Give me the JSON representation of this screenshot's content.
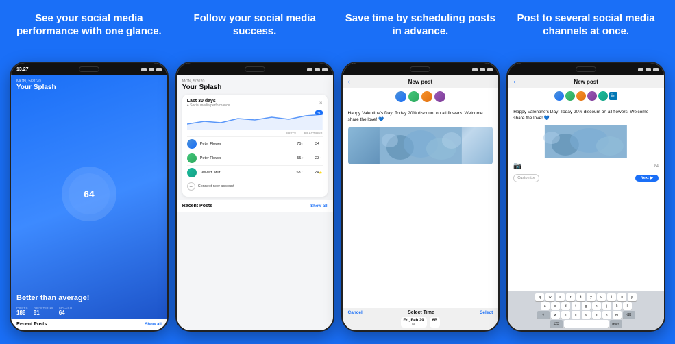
{
  "panels": [
    {
      "id": "panel1",
      "headline": "See your social media performance with one glance.",
      "phone": {
        "time": "13.27",
        "date": "MON, 5/2020",
        "screen_title": "Your Splash",
        "score": "64",
        "better_text": "Better than average!",
        "stats": [
          {
            "label": "POSTS",
            "value": "188"
          },
          {
            "label": "REACTIONS",
            "value": "81"
          },
          {
            "label": "SPLASH",
            "value": "64"
          }
        ],
        "recent_label": "Recent Posts",
        "show_all": "Show all"
      }
    },
    {
      "id": "panel2",
      "headline": "Follow your social media success.",
      "phone": {
        "date": "MON, 5/2020",
        "screen_title": "Your Splash",
        "card_title": "Last 30 days",
        "card_subtitle": "● Social media performance",
        "chart_badge": "+4",
        "table_headers": [
          "POSTS",
          "REACTIONS"
        ],
        "rows": [
          {
            "name": "Peter Flower",
            "posts": "75",
            "reactions": "34",
            "starred": false
          },
          {
            "name": "Peter Flower",
            "posts": "55",
            "reactions": "23",
            "starred": false
          },
          {
            "name": "Tesvetti Mur",
            "posts": "58",
            "reactions": "24",
            "starred": true
          }
        ],
        "connect_label": "Connect new account",
        "recent_label": "Recent Posts",
        "show_all": "Show all"
      }
    },
    {
      "id": "panel3",
      "headline": "Save time by scheduling posts in advance.",
      "phone": {
        "top_title": "New post",
        "post_text": "Happy Valentine's Day! Today 20% discount on all flowers. Welcome share the love! 💙",
        "bottom": {
          "cancel_label": "Cancel",
          "select_time_label": "Select Time",
          "select_label": "Select",
          "date_label": "Fri, Feb 29",
          "times": [
            {
              "day": "Fri, Feb 29",
              "slots": [
                "08",
                "6B"
              ]
            },
            {
              "day": "",
              "slots": []
            }
          ]
        }
      }
    },
    {
      "id": "panel4",
      "headline": "Post to several social media channels at once.",
      "phone": {
        "top_title": "New post",
        "post_text": "Happy Valentine's Day! Today 20% discount on all flowers. Welcome share the love! 💙",
        "char_count": "84",
        "customize_label": "Customize",
        "next_label": "Next",
        "keyboard_rows": [
          [
            "q",
            "w",
            "e",
            "r",
            "t",
            "y",
            "u",
            "i",
            "o",
            "p"
          ],
          [
            "a",
            "s",
            "d",
            "f",
            "g",
            "h",
            "j",
            "k",
            "l"
          ],
          [
            "↑",
            "z",
            "x",
            "c",
            "v",
            "b",
            "n",
            "m",
            "⌫"
          ],
          [
            "123",
            " ",
            "return"
          ]
        ]
      }
    }
  ]
}
